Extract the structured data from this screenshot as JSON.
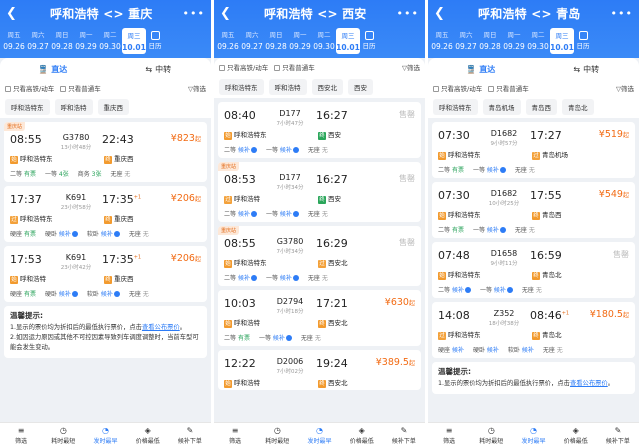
{
  "phones": [
    {
      "route": "呼和浩特 <> 重庆",
      "dates": [
        {
          "w": "周五",
          "n": "09.26"
        },
        {
          "w": "周六",
          "n": "09.27"
        },
        {
          "w": "周日",
          "n": "09.28"
        },
        {
          "w": "周一",
          "n": "09.29"
        },
        {
          "w": "周二",
          "n": "09.30"
        },
        {
          "w": "周三",
          "n": "10.01"
        }
      ],
      "calendar": "日历",
      "tabs": [
        "直达",
        "中转"
      ],
      "filters": [
        "只看高铁/动车",
        "只看普通车",
        "筛选"
      ],
      "chips": [
        "呼和浩特东",
        "呼和浩特",
        "重庆西"
      ],
      "trains": [
        {
          "rec": "重庆站",
          "dep": "08:55",
          "no": "G3780",
          "dur": "13小时48分",
          "arr": "22:43",
          "sup": "",
          "price": "¥823",
          "unit": "起",
          "from": "呼和浩特东",
          "fromTag": "始",
          "to": "重庆西",
          "toTag": "终",
          "seats": [
            [
              "二等",
              "有票"
            ],
            [
              "一等",
              "4张"
            ],
            [
              "商务",
              "3张"
            ],
            [
              "无座",
              "无"
            ]
          ]
        },
        {
          "rec": "",
          "dep": "17:37",
          "no": "K691",
          "dur": "23小时58分",
          "arr": "17:35",
          "sup": "+1",
          "price": "¥206",
          "unit": "起",
          "from": "呼和浩特东",
          "fromTag": "过",
          "to": "重庆西",
          "toTag": "终",
          "seats": [
            [
              "硬座",
              "有票"
            ],
            [
              "硬卧",
              "候补"
            ],
            [
              "软卧",
              "候补"
            ],
            [
              "无座",
              "无"
            ]
          ]
        },
        {
          "rec": "",
          "dep": "17:53",
          "no": "K691",
          "dur": "23小时42分",
          "arr": "17:35",
          "sup": "+1",
          "price": "¥206",
          "unit": "起",
          "from": "呼和浩特",
          "fromTag": "始",
          "to": "重庆西",
          "toTag": "终",
          "seats": [
            [
              "硬座",
              "有票"
            ],
            [
              "硬卧",
              "候补"
            ],
            [
              "软卧",
              "候补"
            ],
            [
              "无座",
              "无"
            ]
          ]
        }
      ],
      "tips_title": "温馨提示:",
      "tips": [
        "1.显示的票价均为折扣后的最低执行票价，点击",
        "查看公布票价",
        "。",
        "2.如因运力原因或其他不可控因素导致列车调度调整时，当前车型可能会发生变动。"
      ]
    },
    {
      "route": "呼和浩特 <> 西安",
      "dates": [
        {
          "w": "周五",
          "n": "09.26"
        },
        {
          "w": "周六",
          "n": "09.27"
        },
        {
          "w": "周日",
          "n": "09.28"
        },
        {
          "w": "周一",
          "n": "09.29"
        },
        {
          "w": "周二",
          "n": "09.30"
        },
        {
          "w": "周三",
          "n": "10.01"
        }
      ],
      "calendar": "日历",
      "filters": [
        "只看高铁/动车",
        "只看普通车",
        "筛选"
      ],
      "chips": [
        "呼和浩特东",
        "呼和浩特",
        "西安北",
        "西安"
      ],
      "trains": [
        {
          "rec": "",
          "dep": "08:40",
          "no": "D177",
          "dur": "7小时47分",
          "arr": "16:27",
          "sup": "",
          "price": "售罄",
          "unit": "",
          "from": "呼和浩特东",
          "fromTag": "始",
          "to": "西安",
          "toTag": "终",
          "seats": [
            [
              "二等",
              "候补"
            ],
            [
              "一等",
              "候补"
            ],
            [
              "无座",
              "无"
            ]
          ]
        },
        {
          "rec": "重庆站",
          "dep": "08:53",
          "no": "D177",
          "dur": "7小时34分",
          "arr": "16:27",
          "sup": "",
          "price": "售罄",
          "unit": "",
          "from": "呼和浩特",
          "fromTag": "过",
          "to": "西安",
          "toTag": "终",
          "seats": [
            [
              "二等",
              "候补"
            ],
            [
              "一等",
              "候补"
            ],
            [
              "无座",
              "无"
            ]
          ]
        },
        {
          "rec": "重庆站",
          "dep": "08:55",
          "no": "G3780",
          "dur": "7小时34分",
          "arr": "16:29",
          "sup": "",
          "price": "售罄",
          "unit": "",
          "from": "呼和浩特东",
          "fromTag": "始",
          "to": "西安北",
          "toTag": "过",
          "seats": [
            [
              "二等",
              "候补"
            ],
            [
              "一等",
              "候补"
            ],
            [
              "无座",
              "无"
            ]
          ]
        },
        {
          "rec": "",
          "dep": "10:03",
          "no": "D2794",
          "dur": "7小时18分",
          "arr": "17:21",
          "sup": "",
          "price": "¥630",
          "unit": "起",
          "from": "呼和浩特",
          "fromTag": "始",
          "to": "西安北",
          "toTag": "终",
          "seats": [
            [
              "二等",
              "有票"
            ],
            [
              "一等",
              "候补"
            ],
            [
              "无座",
              "无"
            ]
          ]
        },
        {
          "rec": "",
          "dep": "12:22",
          "no": "D2006",
          "dur": "7小时02分",
          "arr": "19:24",
          "sup": "",
          "price": "¥389.5",
          "unit": "起",
          "from": "呼和浩特",
          "fromTag": "始",
          "to": "西安北",
          "toTag": "终",
          "seats": []
        }
      ]
    },
    {
      "route": "呼和浩特 <> 青岛",
      "dates": [
        {
          "w": "周五",
          "n": "09.26"
        },
        {
          "w": "周六",
          "n": "09.27"
        },
        {
          "w": "周日",
          "n": "09.28"
        },
        {
          "w": "周一",
          "n": "09.29"
        },
        {
          "w": "周二",
          "n": "09.30"
        },
        {
          "w": "周三",
          "n": "10.01"
        }
      ],
      "calendar": "日历",
      "tabs": [
        "直达",
        "中转"
      ],
      "filters": [
        "只看高铁/动车",
        "只看普通车",
        "筛选"
      ],
      "chips": [
        "呼和浩特东",
        "青岛机场",
        "青岛西",
        "青岛北"
      ],
      "trains": [
        {
          "rec": "",
          "dep": "07:30",
          "no": "D1682",
          "dur": "9小时57分",
          "arr": "17:27",
          "sup": "",
          "price": "¥519",
          "unit": "起",
          "from": "呼和浩特东",
          "fromTag": "始",
          "to": "青岛机场",
          "toTag": "过",
          "seats": [
            [
              "二等",
              "有票"
            ],
            [
              "一等",
              "候补"
            ],
            [
              "无座",
              "无"
            ]
          ]
        },
        {
          "rec": "",
          "dep": "07:30",
          "no": "D1682",
          "dur": "10小时25分",
          "arr": "17:55",
          "sup": "",
          "price": "¥549",
          "unit": "起",
          "from": "呼和浩特东",
          "fromTag": "始",
          "to": "青岛西",
          "toTag": "终",
          "seats": [
            [
              "二等",
              "有票"
            ],
            [
              "一等",
              "候补"
            ],
            [
              "无座",
              "无"
            ]
          ]
        },
        {
          "rec": "",
          "dep": "07:48",
          "no": "D1658",
          "dur": "9小时11分",
          "arr": "16:59",
          "sup": "",
          "price": "售罄",
          "unit": "",
          "from": "呼和浩特东",
          "fromTag": "始",
          "to": "青岛北",
          "toTag": "终",
          "seats": [
            [
              "二等",
              "候补"
            ],
            [
              "一等",
              "候补"
            ],
            [
              "无座",
              "无"
            ]
          ]
        },
        {
          "rec": "",
          "dep": "14:08",
          "no": "Z352",
          "dur": "18小时38分",
          "arr": "08:46",
          "sup": "+1",
          "price": "¥180.5",
          "unit": "起",
          "from": "呼和浩特东",
          "fromTag": "过",
          "to": "青岛北",
          "toTag": "终",
          "seats": [
            [
              "硬座",
              "候补"
            ],
            [
              "硬卧",
              "候补"
            ],
            [
              "软卧",
              "候补"
            ],
            [
              "无座",
              "无"
            ]
          ]
        }
      ],
      "tips_title": "温馨提示:",
      "tips": [
        "1.显示的票价均为折扣后的最低执行票价，点击",
        "查看公布票价",
        "。"
      ]
    }
  ],
  "bottom": [
    {
      "icon": "≡",
      "label": "筛选"
    },
    {
      "icon": "◷",
      "label": "耗时最短"
    },
    {
      "icon": "◔",
      "label": "发时最早"
    },
    {
      "icon": "◈",
      "label": "价格最低"
    },
    {
      "icon": "✎",
      "label": "候补下单"
    }
  ]
}
